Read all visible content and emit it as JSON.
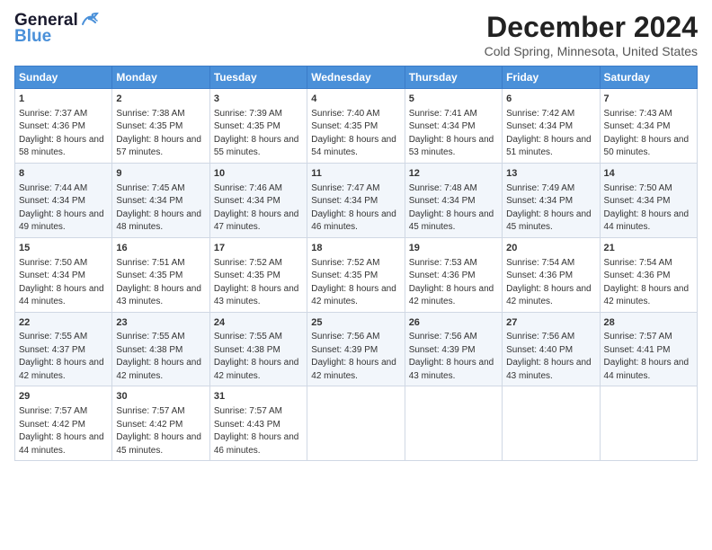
{
  "header": {
    "logo_line1": "General",
    "logo_line2": "Blue",
    "main_title": "December 2024",
    "subtitle": "Cold Spring, Minnesota, United States"
  },
  "calendar": {
    "headers": [
      "Sunday",
      "Monday",
      "Tuesday",
      "Wednesday",
      "Thursday",
      "Friday",
      "Saturday"
    ],
    "rows": [
      [
        {
          "day": "1",
          "sunrise": "Sunrise: 7:37 AM",
          "sunset": "Sunset: 4:36 PM",
          "daylight": "Daylight: 8 hours and 58 minutes."
        },
        {
          "day": "2",
          "sunrise": "Sunrise: 7:38 AM",
          "sunset": "Sunset: 4:35 PM",
          "daylight": "Daylight: 8 hours and 57 minutes."
        },
        {
          "day": "3",
          "sunrise": "Sunrise: 7:39 AM",
          "sunset": "Sunset: 4:35 PM",
          "daylight": "Daylight: 8 hours and 55 minutes."
        },
        {
          "day": "4",
          "sunrise": "Sunrise: 7:40 AM",
          "sunset": "Sunset: 4:35 PM",
          "daylight": "Daylight: 8 hours and 54 minutes."
        },
        {
          "day": "5",
          "sunrise": "Sunrise: 7:41 AM",
          "sunset": "Sunset: 4:34 PM",
          "daylight": "Daylight: 8 hours and 53 minutes."
        },
        {
          "day": "6",
          "sunrise": "Sunrise: 7:42 AM",
          "sunset": "Sunset: 4:34 PM",
          "daylight": "Daylight: 8 hours and 51 minutes."
        },
        {
          "day": "7",
          "sunrise": "Sunrise: 7:43 AM",
          "sunset": "Sunset: 4:34 PM",
          "daylight": "Daylight: 8 hours and 50 minutes."
        }
      ],
      [
        {
          "day": "8",
          "sunrise": "Sunrise: 7:44 AM",
          "sunset": "Sunset: 4:34 PM",
          "daylight": "Daylight: 8 hours and 49 minutes."
        },
        {
          "day": "9",
          "sunrise": "Sunrise: 7:45 AM",
          "sunset": "Sunset: 4:34 PM",
          "daylight": "Daylight: 8 hours and 48 minutes."
        },
        {
          "day": "10",
          "sunrise": "Sunrise: 7:46 AM",
          "sunset": "Sunset: 4:34 PM",
          "daylight": "Daylight: 8 hours and 47 minutes."
        },
        {
          "day": "11",
          "sunrise": "Sunrise: 7:47 AM",
          "sunset": "Sunset: 4:34 PM",
          "daylight": "Daylight: 8 hours and 46 minutes."
        },
        {
          "day": "12",
          "sunrise": "Sunrise: 7:48 AM",
          "sunset": "Sunset: 4:34 PM",
          "daylight": "Daylight: 8 hours and 45 minutes."
        },
        {
          "day": "13",
          "sunrise": "Sunrise: 7:49 AM",
          "sunset": "Sunset: 4:34 PM",
          "daylight": "Daylight: 8 hours and 45 minutes."
        },
        {
          "day": "14",
          "sunrise": "Sunrise: 7:50 AM",
          "sunset": "Sunset: 4:34 PM",
          "daylight": "Daylight: 8 hours and 44 minutes."
        }
      ],
      [
        {
          "day": "15",
          "sunrise": "Sunrise: 7:50 AM",
          "sunset": "Sunset: 4:34 PM",
          "daylight": "Daylight: 8 hours and 44 minutes."
        },
        {
          "day": "16",
          "sunrise": "Sunrise: 7:51 AM",
          "sunset": "Sunset: 4:35 PM",
          "daylight": "Daylight: 8 hours and 43 minutes."
        },
        {
          "day": "17",
          "sunrise": "Sunrise: 7:52 AM",
          "sunset": "Sunset: 4:35 PM",
          "daylight": "Daylight: 8 hours and 43 minutes."
        },
        {
          "day": "18",
          "sunrise": "Sunrise: 7:52 AM",
          "sunset": "Sunset: 4:35 PM",
          "daylight": "Daylight: 8 hours and 42 minutes."
        },
        {
          "day": "19",
          "sunrise": "Sunrise: 7:53 AM",
          "sunset": "Sunset: 4:36 PM",
          "daylight": "Daylight: 8 hours and 42 minutes."
        },
        {
          "day": "20",
          "sunrise": "Sunrise: 7:54 AM",
          "sunset": "Sunset: 4:36 PM",
          "daylight": "Daylight: 8 hours and 42 minutes."
        },
        {
          "day": "21",
          "sunrise": "Sunrise: 7:54 AM",
          "sunset": "Sunset: 4:36 PM",
          "daylight": "Daylight: 8 hours and 42 minutes."
        }
      ],
      [
        {
          "day": "22",
          "sunrise": "Sunrise: 7:55 AM",
          "sunset": "Sunset: 4:37 PM",
          "daylight": "Daylight: 8 hours and 42 minutes."
        },
        {
          "day": "23",
          "sunrise": "Sunrise: 7:55 AM",
          "sunset": "Sunset: 4:38 PM",
          "daylight": "Daylight: 8 hours and 42 minutes."
        },
        {
          "day": "24",
          "sunrise": "Sunrise: 7:55 AM",
          "sunset": "Sunset: 4:38 PM",
          "daylight": "Daylight: 8 hours and 42 minutes."
        },
        {
          "day": "25",
          "sunrise": "Sunrise: 7:56 AM",
          "sunset": "Sunset: 4:39 PM",
          "daylight": "Daylight: 8 hours and 42 minutes."
        },
        {
          "day": "26",
          "sunrise": "Sunrise: 7:56 AM",
          "sunset": "Sunset: 4:39 PM",
          "daylight": "Daylight: 8 hours and 43 minutes."
        },
        {
          "day": "27",
          "sunrise": "Sunrise: 7:56 AM",
          "sunset": "Sunset: 4:40 PM",
          "daylight": "Daylight: 8 hours and 43 minutes."
        },
        {
          "day": "28",
          "sunrise": "Sunrise: 7:57 AM",
          "sunset": "Sunset: 4:41 PM",
          "daylight": "Daylight: 8 hours and 44 minutes."
        }
      ],
      [
        {
          "day": "29",
          "sunrise": "Sunrise: 7:57 AM",
          "sunset": "Sunset: 4:42 PM",
          "daylight": "Daylight: 8 hours and 44 minutes."
        },
        {
          "day": "30",
          "sunrise": "Sunrise: 7:57 AM",
          "sunset": "Sunset: 4:42 PM",
          "daylight": "Daylight: 8 hours and 45 minutes."
        },
        {
          "day": "31",
          "sunrise": "Sunrise: 7:57 AM",
          "sunset": "Sunset: 4:43 PM",
          "daylight": "Daylight: 8 hours and 46 minutes."
        },
        null,
        null,
        null,
        null
      ]
    ]
  }
}
